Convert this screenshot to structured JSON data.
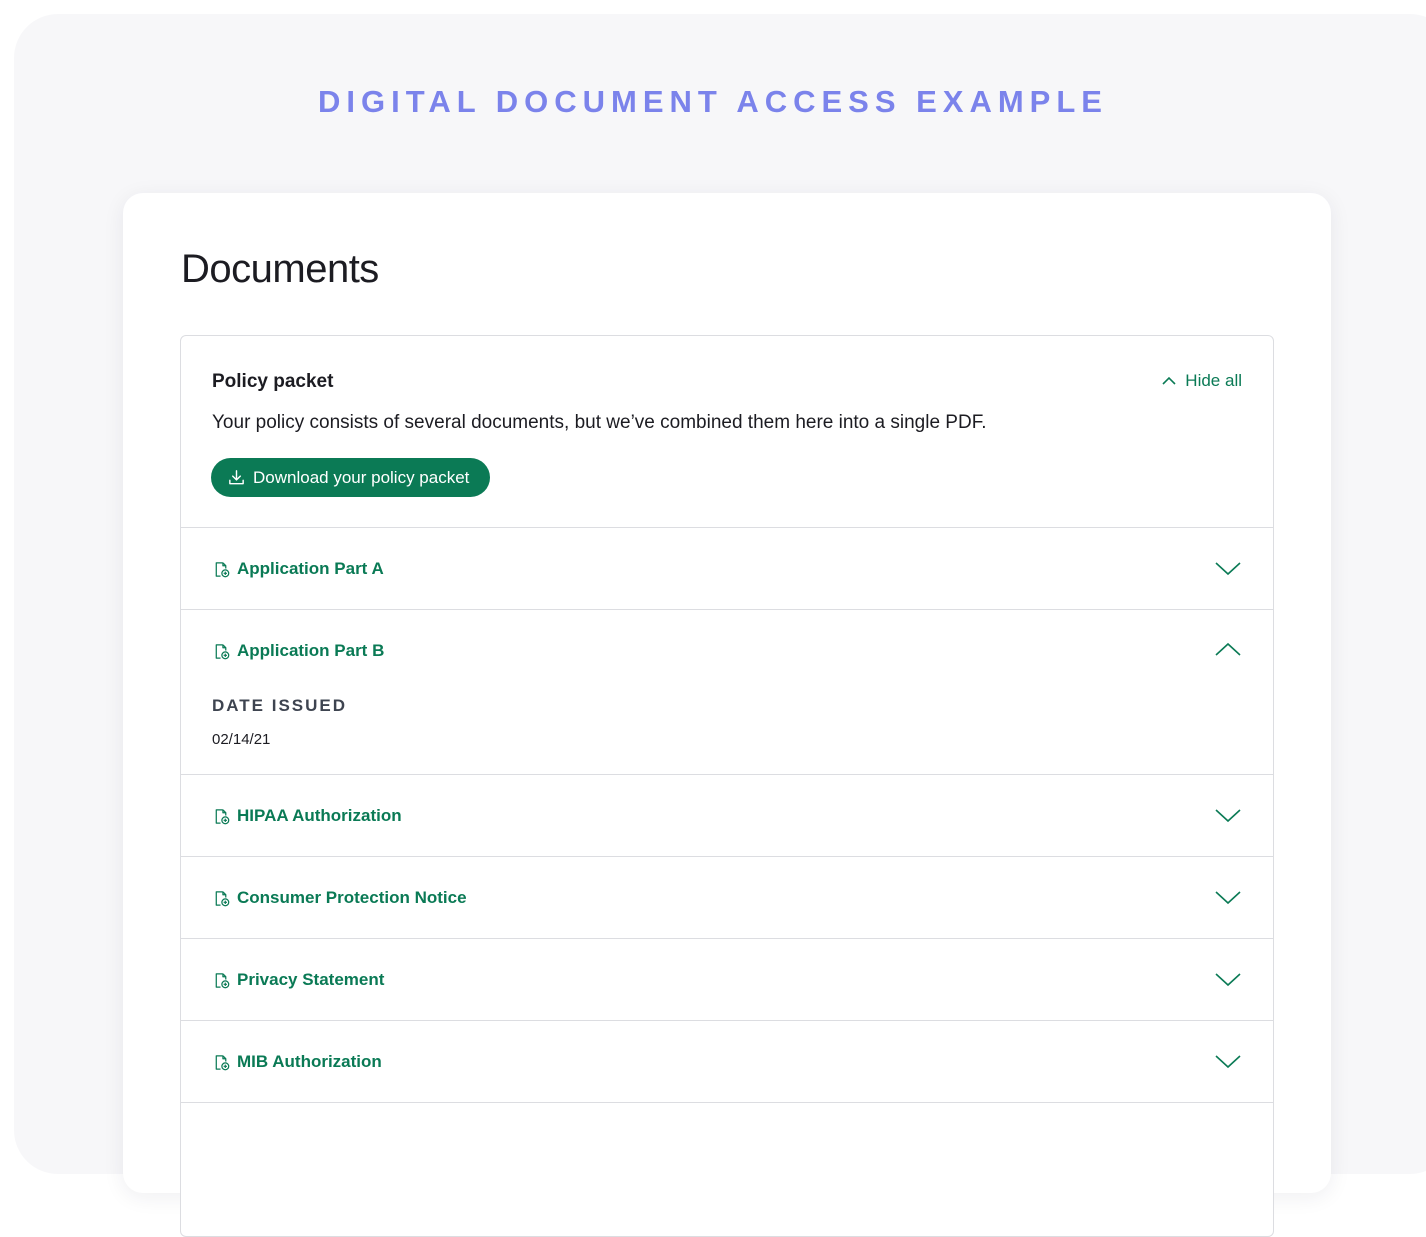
{
  "header": {
    "example_title": "DIGITAL DOCUMENT ACCESS EXAMPLE"
  },
  "page": {
    "title": "Documents"
  },
  "policy_packet": {
    "title": "Policy packet",
    "hide_all_label": "Hide all",
    "description": "Your policy consists of several documents, but we’ve combined them here into a single PDF.",
    "download_label": "Download your policy packet"
  },
  "documents": [
    {
      "name": "Application Part A",
      "expanded": false
    },
    {
      "name": "Application Part B",
      "expanded": true,
      "date_label": "DATE ISSUED",
      "date_value": "02/14/21"
    },
    {
      "name": "HIPAA Authorization",
      "expanded": false
    },
    {
      "name": "Consumer Protection Notice",
      "expanded": false
    },
    {
      "name": "Privacy Statement",
      "expanded": false
    },
    {
      "name": "MIB Authorization",
      "expanded": false
    }
  ],
  "colors": {
    "accent_green": "#0b7a55",
    "example_title_purple": "#7b83eb",
    "border": "#dcdde1"
  },
  "icons": {
    "document": "document-add-icon",
    "collapse": "chevron-up-icon",
    "expand": "chevron-down-icon",
    "download": "download-icon"
  }
}
